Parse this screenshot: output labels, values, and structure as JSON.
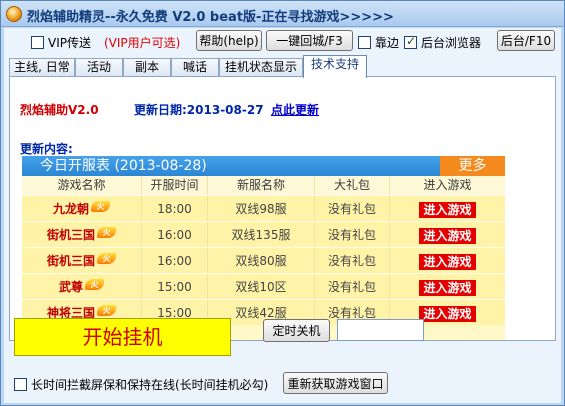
{
  "window": {
    "title": "烈焰辅助精灵--永久免费 V2.0 beat版-正在寻找游戏>>>>>"
  },
  "toolbar": {
    "vip_send_label": "VIP传送",
    "vip_send_checked": false,
    "vip_note": "(VIP用户可选)",
    "help_label": "帮助(help)",
    "return_city_label": "一键回城/F3",
    "edge_label": "靠边",
    "edge_checked": false,
    "background_browser_label": "后台浏览器",
    "background_browser_checked": true,
    "background_label": "后台/F10"
  },
  "tabs": [
    {
      "label": "主线, 日常",
      "active": false
    },
    {
      "label": "活动",
      "active": false
    },
    {
      "label": "副本",
      "active": false
    },
    {
      "label": "喊话",
      "active": false
    },
    {
      "label": "挂机状态显示",
      "active": false
    },
    {
      "label": "技术支持",
      "active": true
    }
  ],
  "support": {
    "version": "烈焰辅助V2.0",
    "update_date": "更新日期:2013-08-27",
    "update_link": "点此更新",
    "changes_label": "更新内容:"
  },
  "server_table": {
    "title": "今日开服表 (2013-08-28)",
    "more_label": "更多",
    "headers": [
      "游戏名称",
      "开服时间",
      "新服名称",
      "大礼包",
      "进入游戏"
    ],
    "rows": [
      {
        "game": "九龙朝",
        "time": "18:00",
        "server": "双线98服",
        "gift": "没有礼包",
        "enter": "进入游戏"
      },
      {
        "game": "街机三国",
        "time": "16:00",
        "server": "双线135服",
        "gift": "没有礼包",
        "enter": "进入游戏"
      },
      {
        "game": "街机三国",
        "time": "16:00",
        "server": "双线80服",
        "gift": "没有礼包",
        "enter": "进入游戏"
      },
      {
        "game": "武尊",
        "time": "15:00",
        "server": "双线10区",
        "gift": "没有礼包",
        "enter": "进入游戏"
      },
      {
        "game": "神将三国",
        "time": "15:00",
        "server": "双线42服",
        "gift": "没有礼包",
        "enter": "进入游戏"
      }
    ],
    "fire_badge": "火"
  },
  "bottom": {
    "start_label": "开始挂机",
    "timer_shutdown_label": "定时关机",
    "timer_value": "",
    "keep_online_label": "长时间拦截屏保和保持在线(长时间挂机必勾)",
    "keep_online_checked": false,
    "refresh_window_label": "重新获取游戏窗口"
  },
  "colors": {
    "accent": "#2b86d4",
    "more": "#f58b1f",
    "enter": "#e30000",
    "start_bg": "#ffff00",
    "start_text": "#d00000"
  }
}
